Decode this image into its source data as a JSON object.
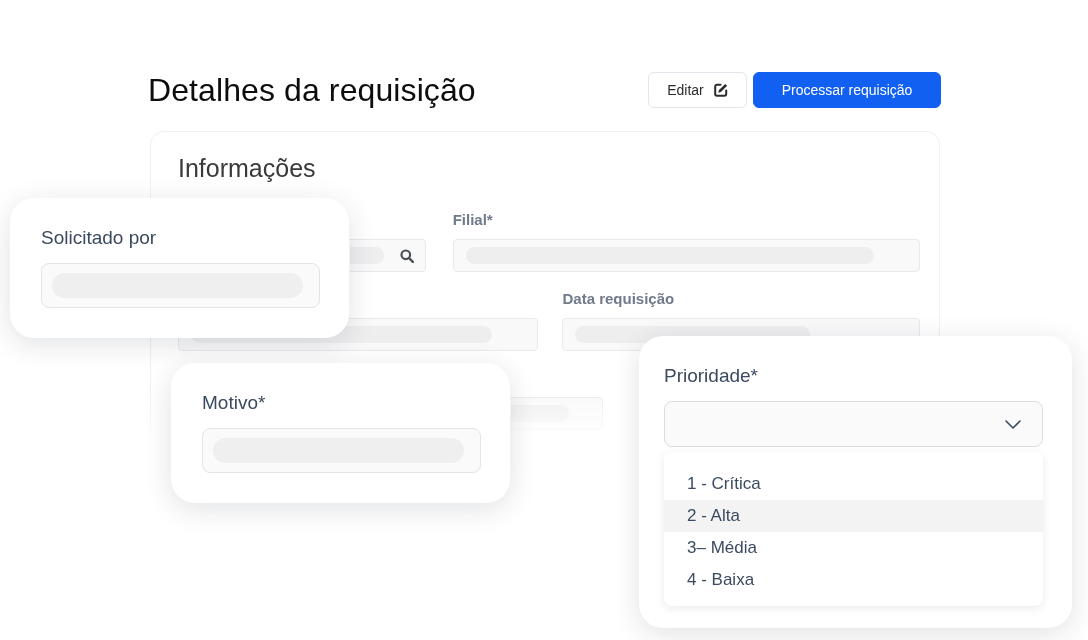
{
  "header": {
    "title": "Detalhes da requisição",
    "buttons": [
      {
        "label": "Editar",
        "kind": "secondary"
      },
      {
        "label": "Processar requisição",
        "kind": "primary"
      }
    ]
  },
  "info_panel": {
    "title": "Informações",
    "rows": [
      [
        {
          "kind": "search"
        },
        {
          "label": "Filial*",
          "kind": "text"
        }
      ],
      [
        {
          "kind": "text"
        },
        {
          "label": "Data requisição",
          "kind": "text"
        }
      ],
      [
        {
          "kind": "text"
        }
      ]
    ]
  },
  "cards": [
    {
      "label": "Solicitado por",
      "kind": "text"
    },
    {
      "label": "Motivo*",
      "kind": "text"
    },
    {
      "label": "Prioridade*",
      "kind": "select",
      "expanded": true,
      "options": [
        {
          "label": "1 - Crítica",
          "selected": false
        },
        {
          "label": "2 - Alta",
          "selected": true
        },
        {
          "label": "3– Média",
          "selected": false
        },
        {
          "label": "4 - Baixa",
          "selected": false
        }
      ]
    }
  ]
}
